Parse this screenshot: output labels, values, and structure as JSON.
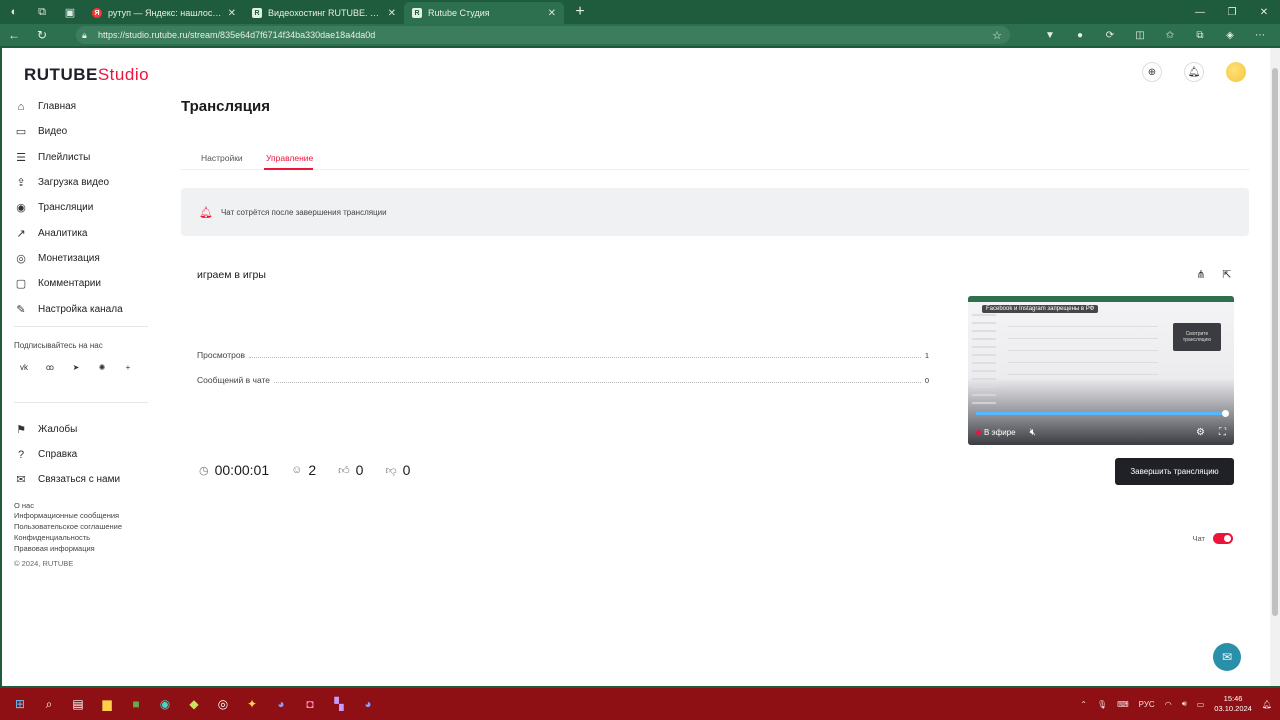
{
  "browser": {
    "tabs": [
      {
        "favicon": "Я",
        "title": "рутуп — Яндекс: нашлось 3 тыс...",
        "active": false
      },
      {
        "favicon": "R",
        "title": "Видеохостинг RUTUBE. Смотрите...",
        "active": false
      },
      {
        "favicon": "R",
        "title": "Rutube Студия",
        "active": true
      }
    ],
    "url": "https://studio.rutube.ru/stream/835e64d7f6714f34ba330dae18a4da0d"
  },
  "logo": {
    "brand": "RUTUBE",
    "product": "Studio"
  },
  "sidebar": {
    "main_items": [
      {
        "icon": "home-icon",
        "glyph": "⌂",
        "label": "Главная"
      },
      {
        "icon": "video-icon",
        "glyph": "▭",
        "label": "Видео"
      },
      {
        "icon": "playlist-icon",
        "glyph": "☰",
        "label": "Плейлисты"
      },
      {
        "icon": "upload-icon",
        "glyph": "⇪",
        "label": "Загрузка видео"
      },
      {
        "icon": "broadcast-icon",
        "glyph": "◉",
        "label": "Трансляции"
      },
      {
        "icon": "analytics-icon",
        "glyph": "↗",
        "label": "Аналитика"
      },
      {
        "icon": "monetization-icon",
        "glyph": "◎",
        "label": "Монетизация"
      },
      {
        "icon": "comments-icon",
        "glyph": "▢",
        "label": "Комментарии"
      },
      {
        "icon": "channel-settings-icon",
        "glyph": "✎",
        "label": "Настройка канала"
      }
    ],
    "subscribe_label": "Подписывайтесь на нас",
    "social": [
      "vk",
      "ok",
      "tg",
      "dzen",
      "+"
    ],
    "secondary_items": [
      {
        "icon": "complaints-icon",
        "glyph": "⚑",
        "label": "Жалобы"
      },
      {
        "icon": "help-icon",
        "glyph": "?",
        "label": "Справка"
      },
      {
        "icon": "contact-icon",
        "glyph": "✉",
        "label": "Связаться с нами"
      }
    ],
    "footer_links": [
      "О нас",
      "Информационные сообщения",
      "Пользовательское соглашение",
      "Конфиденциальность",
      "Правовая информация"
    ],
    "copyright": "© 2024, RUTUBE"
  },
  "main": {
    "title": "Трансляция",
    "tabs": [
      {
        "label": "Настройки",
        "active": false
      },
      {
        "label": "Управление",
        "active": true
      }
    ],
    "alert": "Чат сотрётся после завершения трансляции",
    "stream": {
      "title": "играем в игры",
      "stats": [
        {
          "label": "Просмотров",
          "value": "1"
        },
        {
          "label": "Сообщений в чате",
          "value": "0"
        }
      ],
      "duration": "00:00:01",
      "viewers": "2",
      "likes": "0",
      "dislikes": "0",
      "preview": {
        "banner": "Facebook и Instagram запрещены в РФ",
        "mini_box": "Смотрите трансляцию",
        "live_label": "В эфире",
        "progress": 1.0
      },
      "end_button": "Завершить трансляцию"
    },
    "chat": {
      "label": "Чат",
      "enabled": true
    }
  },
  "taskbar": {
    "lang": "РУС",
    "time": "15:46",
    "date": "03.10.2024"
  },
  "colors": {
    "accent": "#ed143b",
    "browser": "#2d7050",
    "taskbar": "#8e1015"
  }
}
